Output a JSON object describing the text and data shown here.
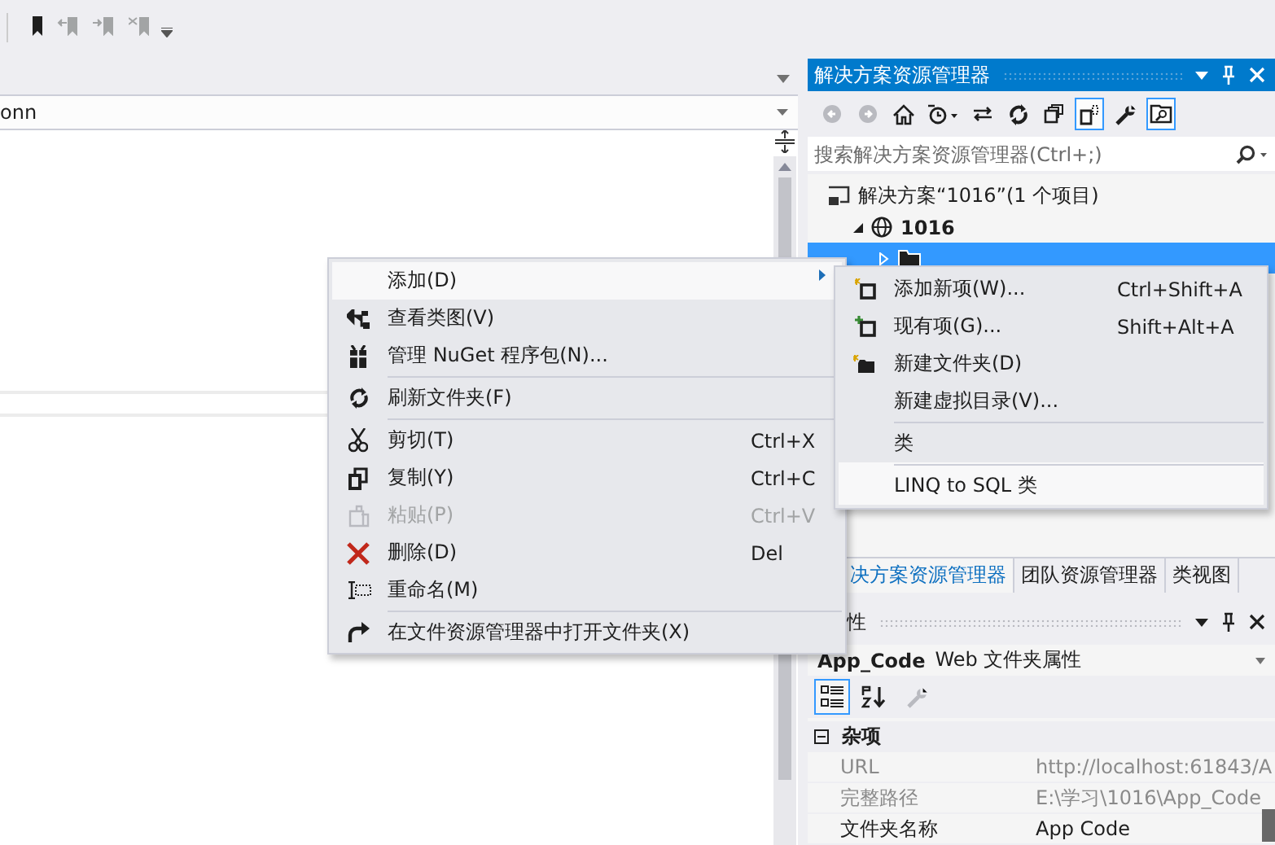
{
  "toolbar": {
    "buttons": [
      {
        "kind": "bookmark",
        "disabled": false
      },
      {
        "kind": "previous-bookmark",
        "disabled": true
      },
      {
        "kind": "next-bookmark",
        "disabled": true
      },
      {
        "kind": "clear-bookmarks",
        "disabled": true
      }
    ]
  },
  "editor": {
    "navigation_combo": {
      "value": "onn"
    }
  },
  "solution_explorer": {
    "title": "解决方案资源管理器",
    "toolbar": [
      {
        "kind": "back",
        "disabled": true,
        "pressed": false
      },
      {
        "kind": "forward",
        "disabled": true,
        "pressed": false
      },
      {
        "kind": "home",
        "disabled": false,
        "pressed": false
      },
      {
        "kind": "history",
        "disabled": false,
        "pressed": false
      },
      {
        "kind": "sync",
        "disabled": false,
        "pressed": false
      },
      {
        "kind": "refresh",
        "disabled": false,
        "pressed": false
      },
      {
        "kind": "collapse",
        "disabled": false,
        "pressed": false
      },
      {
        "kind": "show-all",
        "disabled": false,
        "pressed": true
      },
      {
        "kind": "properties",
        "disabled": false,
        "pressed": false
      },
      {
        "kind": "preview",
        "disabled": false,
        "pressed": true
      }
    ],
    "search": {
      "placeholder": "搜索解决方案资源管理器(Ctrl+;)"
    },
    "tree": [
      {
        "label": "解决方案“1016”(1 个项目)",
        "kind": "solution",
        "selected": false,
        "expanded": true,
        "children": [
          {
            "label": "1016",
            "kind": "website",
            "selected": false,
            "expanded": true,
            "children": [
              {
                "kind": "folder",
                "selected": true,
                "expanded": false
              }
            ]
          }
        ]
      }
    ],
    "tabs": [
      {
        "label": "决方案资源管理器",
        "selected": true
      },
      {
        "label": "团队资源管理器",
        "selected": false
      },
      {
        "label": "类视图",
        "selected": false
      }
    ]
  },
  "properties": {
    "title": "性",
    "object": {
      "name": "App_Code",
      "type": "Web 文件夹属性"
    },
    "toolbar": [
      {
        "kind": "categorized",
        "pressed": true,
        "disabled": false
      },
      {
        "kind": "alphabetical",
        "pressed": false,
        "disabled": false
      },
      {
        "kind": "property-pages",
        "pressed": false,
        "disabled": true
      }
    ],
    "category": {
      "label": "杂项",
      "expanded": true
    },
    "rows": [
      {
        "name": "URL",
        "value": "http://localhost:61843/A",
        "disabled": true
      },
      {
        "name": "完整路径",
        "value": "E:\\学习\\1016\\App_Code",
        "disabled": true
      },
      {
        "name": "文件夹名称",
        "value": "App Code",
        "disabled": false
      }
    ]
  },
  "context_menu": {
    "items": [
      {
        "label": "添加(D)",
        "kind": "none",
        "has_submenu": true,
        "disabled": false,
        "selected": true,
        "separator_before": false
      },
      {
        "label": "查看类图(V)",
        "kind": "class-diagram",
        "has_submenu": false,
        "disabled": false,
        "selected": false,
        "separator_before": false
      },
      {
        "label": "管理 NuGet 程序包(N)...",
        "kind": "package",
        "has_submenu": false,
        "disabled": false,
        "selected": false,
        "separator_before": false
      },
      {
        "label": "刷新文件夹(F)",
        "kind": "refresh",
        "has_submenu": false,
        "disabled": false,
        "selected": false,
        "separator_before": true
      },
      {
        "label": "剪切(T)",
        "kind": "cut",
        "shortcut": "Ctrl+X",
        "has_submenu": false,
        "disabled": false,
        "selected": false,
        "separator_before": true
      },
      {
        "label": "复制(Y)",
        "kind": "copy",
        "shortcut": "Ctrl+C",
        "has_submenu": false,
        "disabled": false,
        "selected": false,
        "separator_before": false
      },
      {
        "label": "粘贴(P)",
        "kind": "paste",
        "shortcut": "Ctrl+V",
        "has_submenu": false,
        "disabled": true,
        "selected": false,
        "separator_before": false
      },
      {
        "label": "删除(D)",
        "kind": "delete",
        "shortcut": "Del",
        "has_submenu": false,
        "disabled": false,
        "selected": false,
        "separator_before": false
      },
      {
        "label": "重命名(M)",
        "kind": "rename",
        "has_submenu": false,
        "disabled": false,
        "selected": false,
        "separator_before": false
      },
      {
        "label": "在文件资源管理器中打开文件夹(X)",
        "kind": "open-folder",
        "has_submenu": false,
        "disabled": false,
        "selected": false,
        "separator_before": true
      }
    ]
  },
  "submenu": {
    "items": [
      {
        "label": "添加新项(W)...",
        "kind": "new-item",
        "shortcut": "Ctrl+Shift+A",
        "selected": false,
        "separator_before": false
      },
      {
        "label": "现有项(G)...",
        "kind": "existing-item",
        "shortcut": "Shift+Alt+A",
        "selected": false,
        "separator_before": false
      },
      {
        "label": "新建文件夹(D)",
        "kind": "new-folder",
        "selected": false,
        "separator_before": false
      },
      {
        "label": "新建虚拟目录(V)...",
        "kind": "none",
        "selected": false,
        "separator_before": false
      },
      {
        "label": "类",
        "kind": "none",
        "selected": false,
        "separator_before": true
      },
      {
        "label": "LINQ to SQL 类",
        "kind": "none",
        "selected": true,
        "separator_before": true
      }
    ]
  }
}
